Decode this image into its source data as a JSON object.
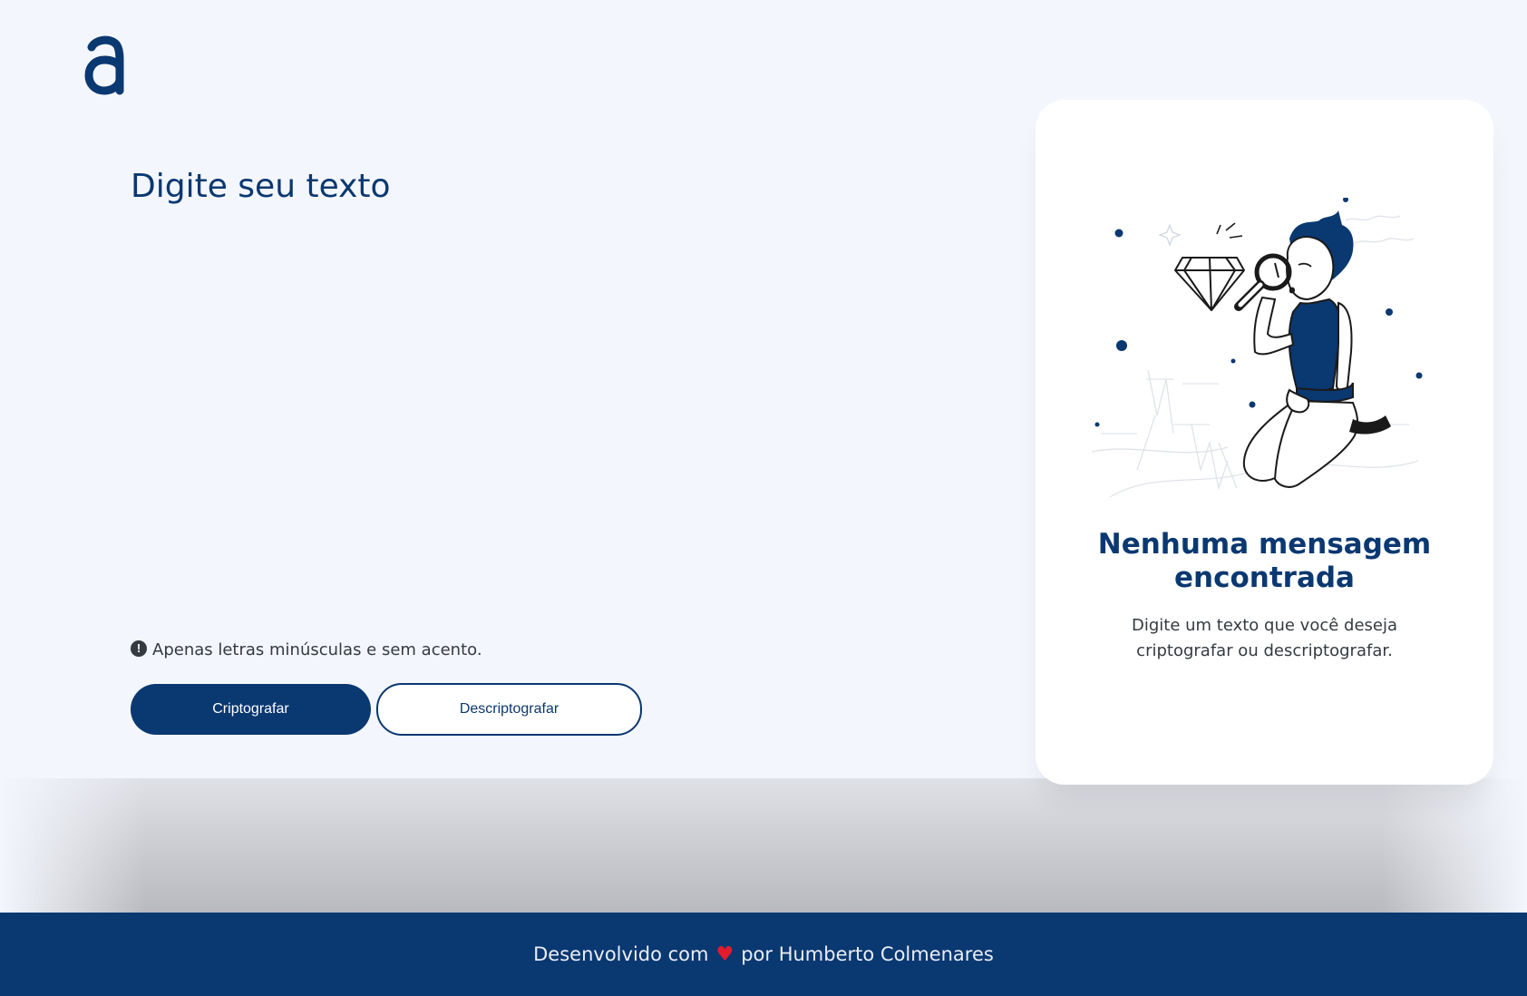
{
  "header": {
    "logo_icon": "alura-a-logo-icon"
  },
  "editor": {
    "placeholder": "Digite seu texto"
  },
  "hint": {
    "icon": "exclamation-circle-icon",
    "text": "Apenas letras minúsculas e sem acento."
  },
  "actions": {
    "encrypt_label": "Criptografar",
    "decrypt_label": "Descriptografar"
  },
  "output": {
    "illustration": "person-with-magnifying-glass-illustration",
    "title": "Nenhuma mensagem encontrada",
    "message": "Digite um texto que você deseja criptografar ou descriptografar."
  },
  "footer": {
    "prefix": "Desenvolvido com",
    "heart": "♥",
    "suffix": "por Humberto Colmenares"
  },
  "colors": {
    "primary": "#0a3871",
    "background": "#f3f6fc",
    "card": "#ffffff",
    "text": "#343a40",
    "heart": "#e31b2b"
  }
}
